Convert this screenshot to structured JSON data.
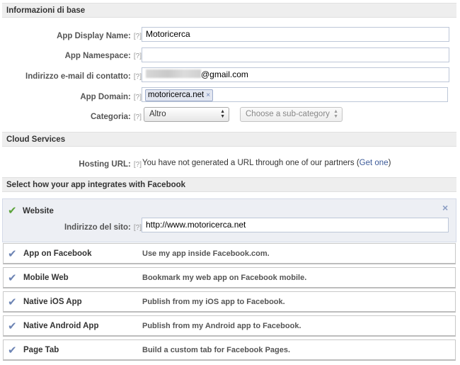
{
  "basic_info": {
    "header": "Informazioni di base",
    "help_label": "[?]",
    "display_name_label": "App Display Name:",
    "display_name_value": "Motoricerca",
    "namespace_label": "App Namespace:",
    "namespace_value": "",
    "email_label": "Indirizzo e-mail di contatto:",
    "email_suffix": "@gmail.com",
    "domain_label": "App Domain:",
    "domain_token": "motoricerca.net",
    "domain_token_remove": "×",
    "category_label": "Categoria:",
    "category_value": "Altro",
    "subcategory_placeholder": "Choose a sub-category"
  },
  "cloud_services": {
    "header": "Cloud Services",
    "hosting_label": "Hosting URL:",
    "hosting_text": "You have not generated a URL through one of our partners (",
    "get_one_link": "Get one",
    "hosting_text_end": ")"
  },
  "integration": {
    "header": "Select how your app integrates with Facebook",
    "website": {
      "title": "Website",
      "site_label": "Indirizzo del sito:",
      "site_value": "http://www.motoricerca.net",
      "close": "×"
    },
    "options": [
      {
        "title": "App on Facebook",
        "desc": "Use my app inside Facebook.com."
      },
      {
        "title": "Mobile Web",
        "desc": "Bookmark my web app on Facebook mobile."
      },
      {
        "title": "Native iOS App",
        "desc": "Publish from my iOS app to Facebook."
      },
      {
        "title": "Native Android App",
        "desc": "Publish from my Android app to Facebook."
      },
      {
        "title": "Page Tab",
        "desc": "Build a custom tab for Facebook Pages."
      }
    ]
  },
  "colors": {
    "link": "#3b5998",
    "check_green": "#5ba33b",
    "check_blue": "#6d84b4",
    "header_bg": "#eeeeee"
  },
  "icons": {
    "check": "✔",
    "arrows": "▲▼"
  }
}
